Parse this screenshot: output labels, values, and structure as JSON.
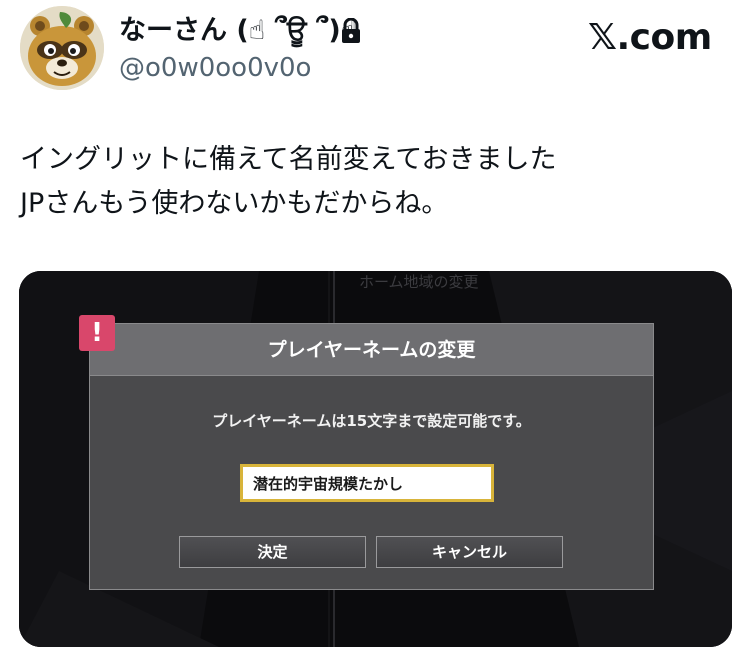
{
  "header": {
    "display_name": "なーさん (☝ ՞ਊ ՞)☝",
    "handle": "@o0w0oo0v0o",
    "site": "𝕏.com"
  },
  "tweet": {
    "lines": [
      "イングリットに備えて名前変えておきました",
      "JPさんもう使わないかもだからね。"
    ]
  },
  "media": {
    "background_panel_title": "ホーム地域の変更",
    "dialog": {
      "alert_glyph": "!",
      "title": "プレイヤーネームの変更",
      "message": "プレイヤーネームは15文字まで設定可能です。",
      "input_value": "潜在的宇宙規模たかし",
      "confirm_label": "決定",
      "cancel_label": "キャンセル"
    }
  },
  "colors": {
    "text_primary": "#0f1419",
    "text_secondary": "#536471",
    "dialog_body": "#4a4a4c",
    "dialog_header": "#6e6e71",
    "alert_badge": "#d9476b",
    "input_border": "#d8b43a"
  },
  "icons": {
    "lock": "lock-icon",
    "alert": "exclamation-icon",
    "avatar": "raccoon-dog-avatar"
  }
}
